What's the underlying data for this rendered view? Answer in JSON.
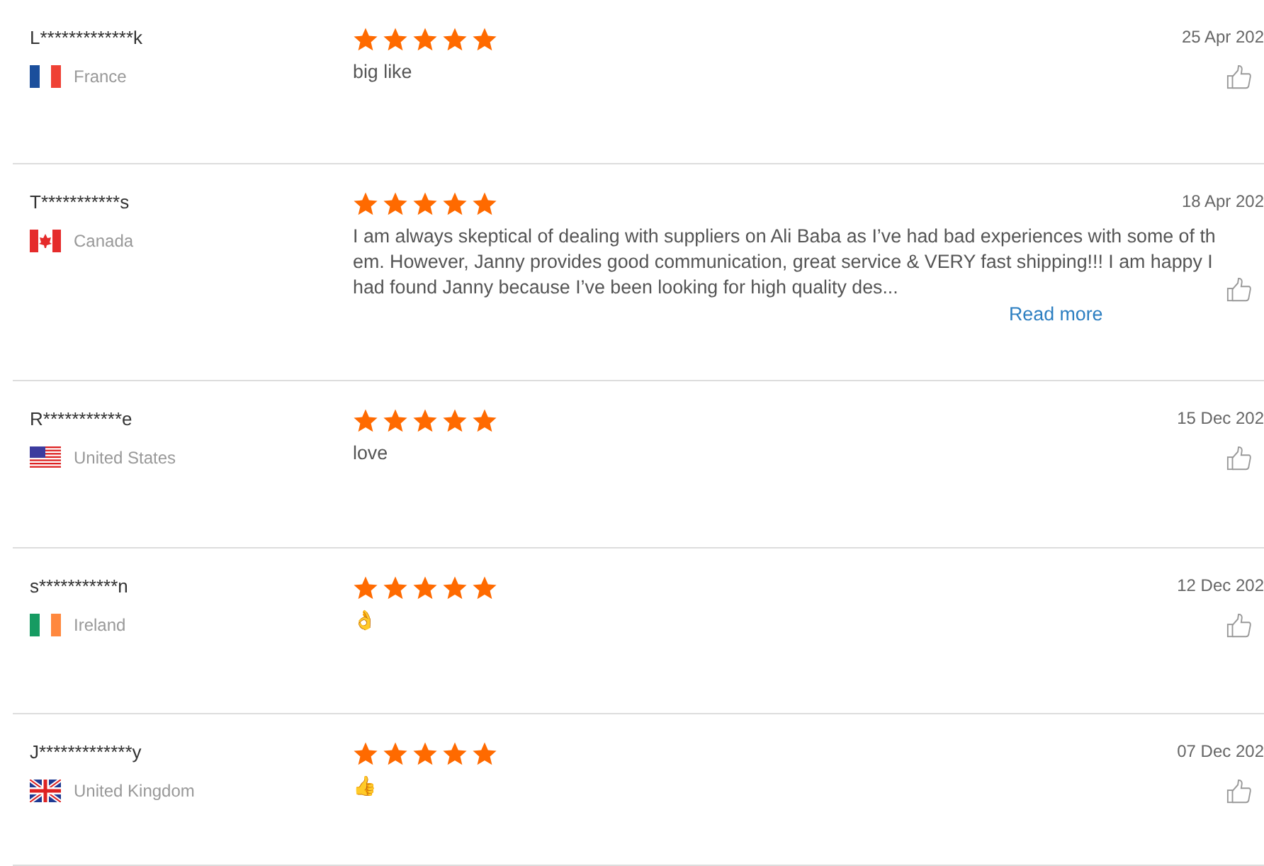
{
  "reviews": [
    {
      "name": "L*************k",
      "flag": {
        "kind": "bluered"
      },
      "country": "France",
      "stars": 5,
      "comment": "big like",
      "date": "25 Apr 202"
    },
    {
      "name": "T***********s",
      "flag": {
        "kind": "maple"
      },
      "country": "Canada",
      "stars": 5,
      "comment": "I am always skeptical of dealing with suppliers on Ali Baba as I’ve had bad experiences with some of them. However, Janny provides good communication, great service & VERY fast shipping!!! I am happy I had found Janny because I’ve been looking for high quality des...",
      "read_more": "Read more",
      "date": "18 Apr 202"
    },
    {
      "name": "R***********e",
      "flag": {
        "kind": "stripes"
      },
      "country": "United States",
      "stars": 5,
      "comment": "love",
      "date": "15 Dec 202"
    },
    {
      "name": "s***********n",
      "flag": {
        "kind": "greenorange"
      },
      "country": "Ireland",
      "stars": 5,
      "comment": "👌",
      "date": "12 Dec 202"
    },
    {
      "name": "J*************y",
      "flag": {
        "kind": "union"
      },
      "country": "United Kingdom",
      "stars": 5,
      "comment": "👍",
      "date": "07 Dec 202"
    }
  ]
}
